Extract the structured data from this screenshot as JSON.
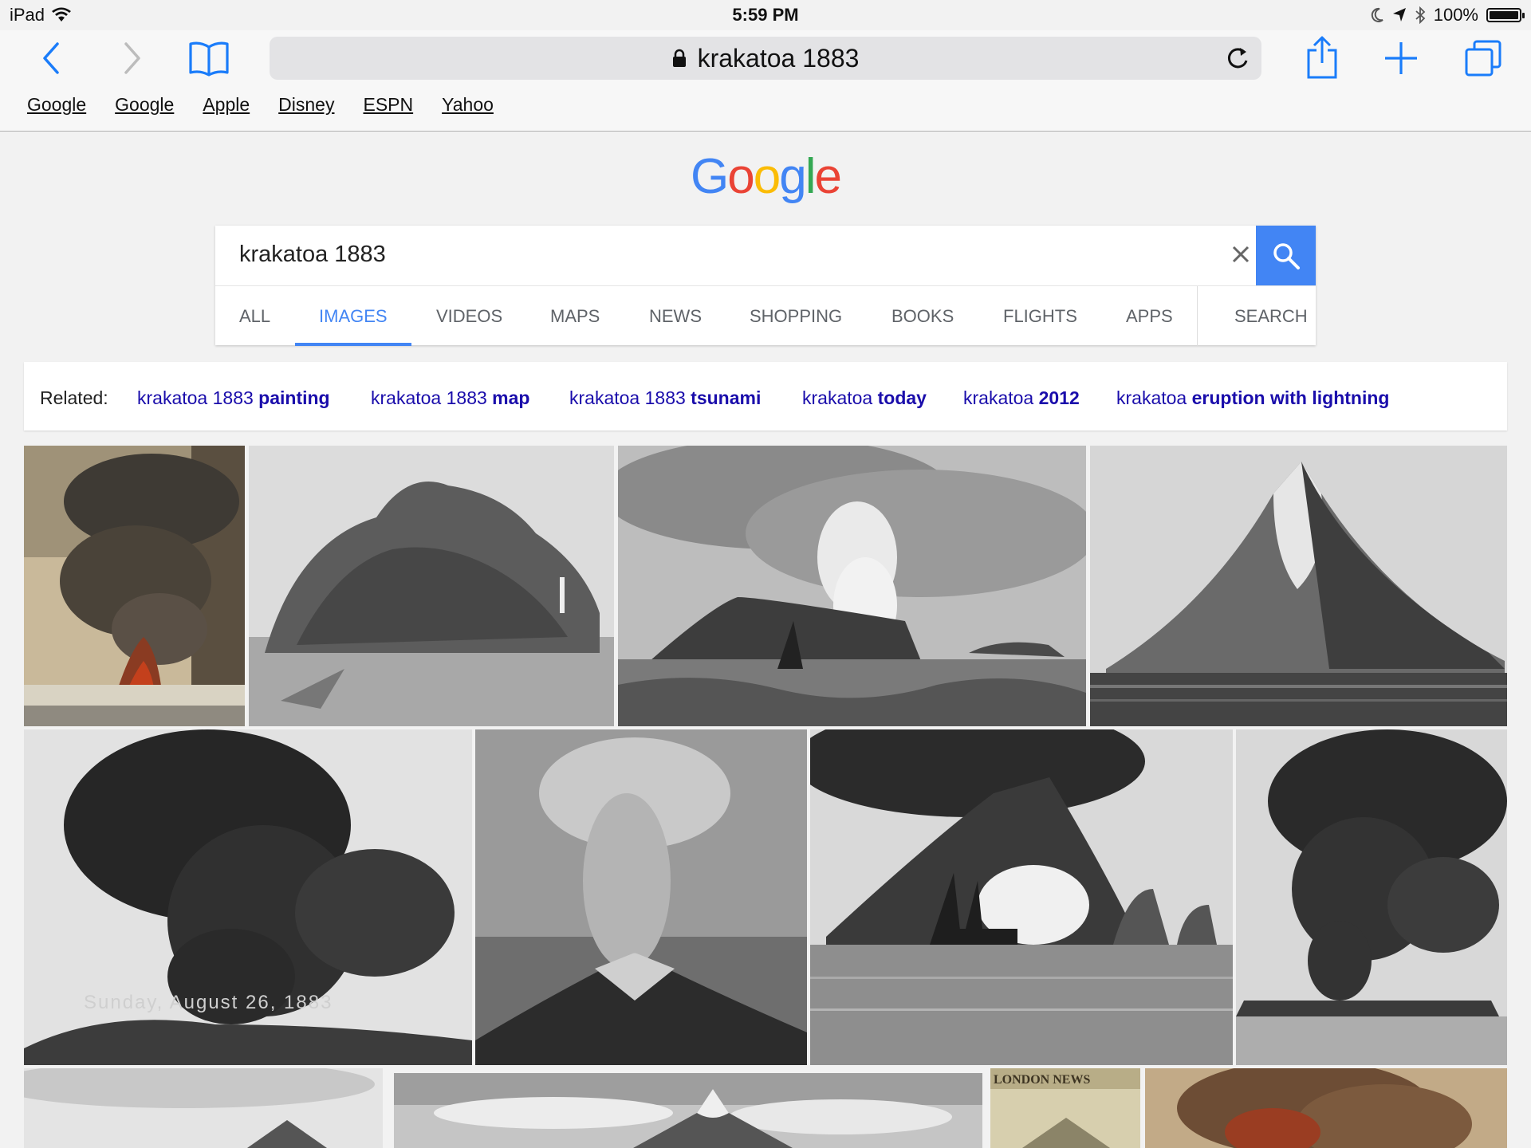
{
  "status_bar": {
    "device": "iPad",
    "time": "5:59 PM",
    "battery": "100%",
    "battery_level": 1.0
  },
  "browser": {
    "url_text": "krakatoa 1883",
    "bookmarks": [
      "Google",
      "Google",
      "Apple",
      "Disney",
      "ESPN",
      "Yahoo"
    ],
    "icons": {
      "back": "chevron-left-icon",
      "forward": "chevron-right-icon",
      "bookmarks": "book-icon",
      "lock": "lock-icon",
      "reload": "reload-icon",
      "share": "share-icon",
      "new_tab": "plus-icon",
      "tabs": "tabs-icon"
    },
    "accent_color": "#1a7cfa"
  },
  "google": {
    "logo_letters": [
      "G",
      "o",
      "o",
      "g",
      "l",
      "e"
    ],
    "logo_colors": [
      "#4285f4",
      "#ea4335",
      "#fbbc05",
      "#4285f4",
      "#34a853",
      "#ea4335"
    ],
    "query": "krakatoa 1883",
    "tabs": [
      "ALL",
      "IMAGES",
      "VIDEOS",
      "MAPS",
      "NEWS",
      "SHOPPING",
      "BOOKS",
      "FLIGHTS",
      "APPS",
      "SEARCH"
    ],
    "active_tab": "IMAGES",
    "related_label": "Related:",
    "related": [
      {
        "base": "krakatoa 1883",
        "bold": "painting"
      },
      {
        "base": "krakatoa 1883",
        "bold": "map"
      },
      {
        "base": "krakatoa 1883",
        "bold": "tsunami"
      },
      {
        "base": "krakatoa",
        "bold": "today"
      },
      {
        "base": "krakatoa",
        "bold": "2012"
      },
      {
        "base": "krakatoa",
        "bold": "eruption with lightning"
      }
    ],
    "link_color": "#1a0dab",
    "blue": "#4285f4"
  },
  "images": {
    "captions": {
      "sunday": "Sunday, August 26, 1883",
      "london_news": "LONDON      NEWS"
    },
    "count": 13
  }
}
